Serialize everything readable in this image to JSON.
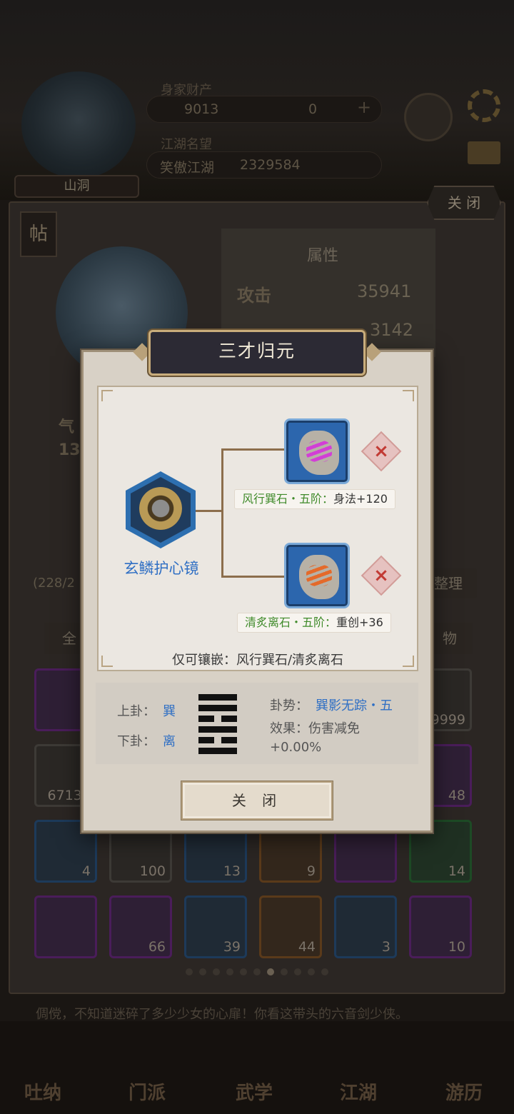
{
  "header": {
    "player_name": "山洞",
    "wealth_label": "身家财产",
    "gold": "9013",
    "jade": "0",
    "plus": "+",
    "reputation_label": "江湖名望",
    "reputation_title": "笑傲江湖",
    "reputation_value": "2329584"
  },
  "panel": {
    "close_label": "关 闭",
    "tie_label": "帖",
    "attributes_title": "属性",
    "attack_label": "攻击",
    "attack_value": "35941",
    "defense_value": "3142",
    "left_stat_1": "气",
    "left_stat_2": "13",
    "bag_count": "(228/2",
    "sort_label": "整理",
    "tab_all": "全",
    "tab_items": "物",
    "inventory": [
      {
        "count": "",
        "quality": "purple"
      },
      {
        "count": "",
        "quality": "gray"
      },
      {
        "count": "",
        "quality": "gray"
      },
      {
        "count": "",
        "quality": "gray"
      },
      {
        "count": "",
        "quality": "gray"
      },
      {
        "count": "99999",
        "quality": "gray"
      },
      {
        "count": "67135",
        "quality": "gray"
      },
      {
        "count": "",
        "quality": "gray"
      },
      {
        "count": "",
        "quality": "gray"
      },
      {
        "count": "",
        "quality": "gray"
      },
      {
        "count": "",
        "quality": "gray"
      },
      {
        "count": "48",
        "quality": "purple"
      },
      {
        "count": "4",
        "quality": "blue"
      },
      {
        "count": "100",
        "quality": "gray"
      },
      {
        "count": "13",
        "quality": "blue"
      },
      {
        "count": "9",
        "quality": "orange"
      },
      {
        "count": "",
        "quality": "purple"
      },
      {
        "count": "14",
        "quality": "green"
      },
      {
        "count": "",
        "quality": "purple"
      },
      {
        "count": "66",
        "quality": "purple"
      },
      {
        "count": "39",
        "quality": "blue"
      },
      {
        "count": "44",
        "quality": "orange"
      },
      {
        "count": "3",
        "quality": "blue"
      },
      {
        "count": "10",
        "quality": "purple"
      }
    ],
    "page_count": 11,
    "page_active": 6
  },
  "scroll_text": "倜傥，不知道迷碎了多少少女的心扉！你看这带头的六音剑少侠。",
  "bottom_nav": [
    "吐纳",
    "门派",
    "武学",
    "江湖",
    "游历"
  ],
  "modal": {
    "title": "三才归元",
    "equipment_name": "玄鳞护心镜",
    "gem1_name": "风行巽石・五阶：",
    "gem1_effect": "身法+120",
    "gem2_name": "清炙离石・五阶：",
    "gem2_effect": "重创+36",
    "embed_note": "仅可镶嵌：风行巽石/清炙离石",
    "upper_label": "上卦：",
    "upper_value": "巽",
    "lower_label": "下卦：",
    "lower_value": "离",
    "momentum_label": "卦势：",
    "momentum_value": "巽影无踪・五",
    "effect_label": "效果：伤害减免+0.00%",
    "close_label": "关 闭",
    "colors": {
      "equip_blue": "#2f6fc4",
      "gem_green": "#3f8a2a",
      "remove_red": "#c23a34"
    }
  }
}
